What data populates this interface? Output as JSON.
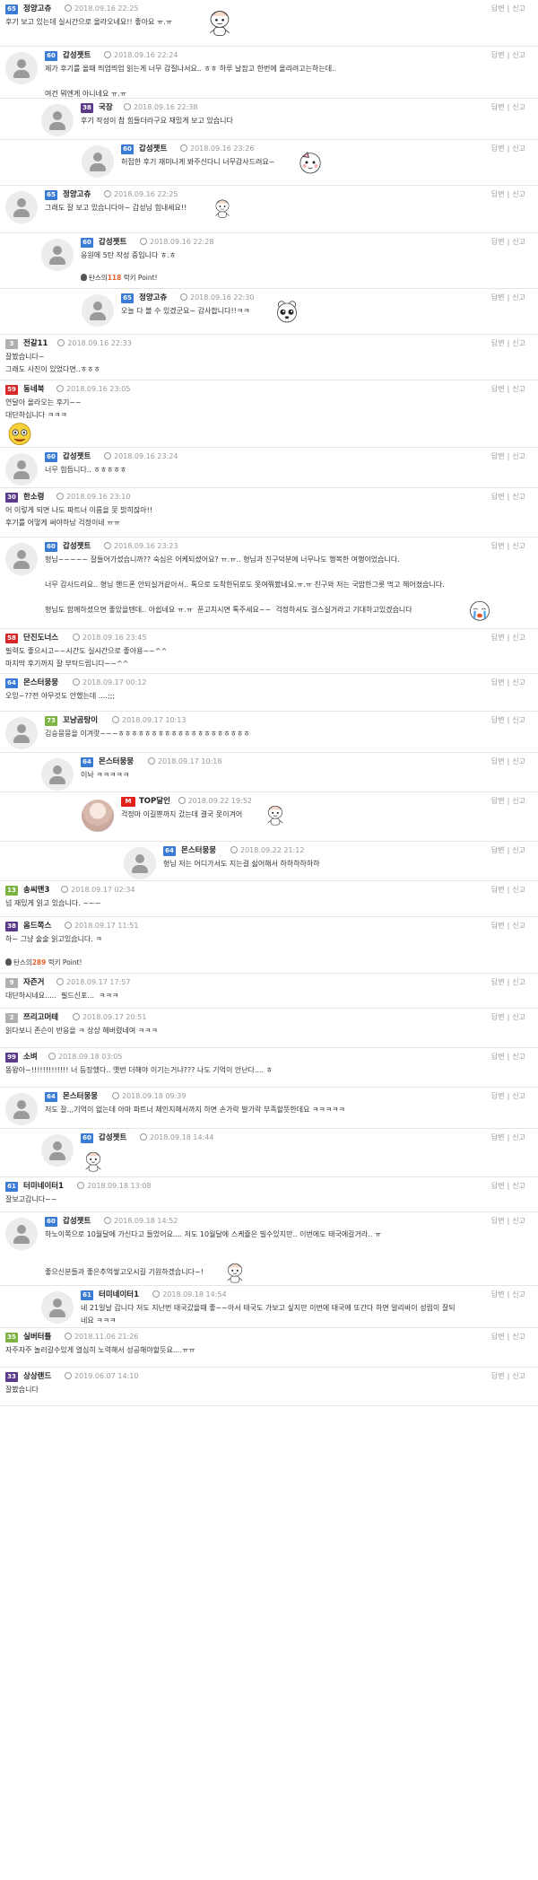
{
  "ui": {
    "reply": "답변",
    "report": "신고"
  },
  "comments": [
    {
      "level": "65",
      "nick": "정양고츄",
      "date": "2018.09.16 22:25",
      "body": "후기 보고 있는데 실시간으로 올라오네요!! 좋아요 ㅠ.ㅠ",
      "sticker": "sticker-mouse-character"
    },
    {
      "level": "60",
      "nick": "갑성젯트",
      "date": "2018.09.16 22:24",
      "body": "제가 후기를 올때 띄엄띄엄 읽는게 너무 감질나서요.. ㅎㅎ 하루 날잡고 한번에 올리려고는하는데..\n\n여건 뭐엔게 아니네요 ㅠ.ㅠ"
    },
    {
      "level": "38",
      "nick": "국장",
      "date": "2018.09.16 22:38",
      "body": "후기 작성이 참 힘들더라구요 재밌게 보고 있습니다"
    },
    {
      "level": "60",
      "nick": "갑성젯트",
      "date": "2018.09.16 23:26",
      "body": "허접한 후기 재미나게 봐주신다니 너무감사드려요~",
      "sticker": "sticker-face-character"
    },
    {
      "level": "65",
      "nick": "정양고츄",
      "date": "2018.09.16 22:25",
      "body": "그래도 잘 보고 있습니다아~ 갑성님 힘내세요!!",
      "sticker": "sticker-cheer-character"
    },
    {
      "level": "60",
      "nick": "갑성젯트",
      "date": "2018.09.16 22:28",
      "body": "응원에 5탄 작성 중입니다 ㅎ.ㅎ",
      "point_prefix": "탄스의",
      "point_amount": "118",
      "point_suffix": "럭키 Point!"
    },
    {
      "level": "65",
      "nick": "정양고츄",
      "date": "2018.09.16 22:30",
      "body": "오늘 다 볼 수 있겠군요~ 감사합니다!!ㅋㅋ",
      "sticker": "sticker-bear-character"
    },
    {
      "level": "3",
      "nick": "전갈11",
      "date": "2018.09.16 22:33",
      "body": "잘봤습니다~\n그래도 사진이 있었다면..ㅎㅎㅎ"
    },
    {
      "level": "59",
      "nick": "동네북",
      "date": "2018.09.16 23:05",
      "body": "연달아 올라오는 후기~~\n대단하십니다 ㅋㅋㅋ",
      "sticker": "sticker-yellow-character"
    },
    {
      "level": "60",
      "nick": "갑성젯트",
      "date": "2018.09.16 23:24",
      "body": "너무 힘듭니다.. ㅎㅎㅎㅎㅎ"
    },
    {
      "level": "30",
      "nick": "한소령",
      "date": "2018.09.16 23:10",
      "body": "어 이렇게 되면 나도 파트너 이름을 못 밝히잖아!!\n후기를 어떻게 써야하남 걱정이네 ㅠㅠ"
    },
    {
      "level": "60",
      "nick": "갑성젯트",
      "date": "2018.09.16 23:23",
      "body": "형님~~~~~ 잘들어가셨습니까?? 숙심은 어케되셨어요? ㅠ.ㅠ.. 형님과 친구덕분에 너무나도 행복한 여행이었습니다.\n\n너무 감사드려요.. 형님 핸드폰 안되실거같아서.. 톡으로 도착한뒤로도 못여쭤봤네요.ㅠ.ㅠ 친구와 저는 국밥한그릇 먹고 헤어졌습니다.\n\n형님도 함께하셨으면 좋았을텐데.. 아쉽네요 ㅠ.ㅠ  푼고치시면 톡주세요~~  걱정하셔도 걸스실거라고 기대하고있겠습니다",
      "sticker": "sticker-crying-character"
    },
    {
      "level": "58",
      "nick": "단진도너스",
      "date": "2018.09.16 23:45",
      "body": "필력도 좋으시고~~시간도 실시간으로 좋아용~~^^\n마지막 후기까지 잘 부탁드립니다~~^^"
    },
    {
      "level": "64",
      "nick": "몬스터뭉뭉",
      "date": "2018.09.17 00:12",
      "body": "오잉~??전 아무것도 안했는데 ....;;;"
    },
    {
      "level": "73",
      "nick": "꼬냥곰탕이",
      "date": "2018.09.17 10:13",
      "body": "김승뭉뭉을 이겨랏~~~ㅎㅎㅎㅎㅎㅎㅎㅎㅎㅎㅎㅎㅎㅎㅎㅎㅎㅎㅎㅎ"
    },
    {
      "level": "64",
      "nick": "몬스터뭉뭉",
      "date": "2018.09.17 10:18",
      "body": "이놔 ㅋㅋㅋㅋㅋ"
    },
    {
      "level": "M",
      "nick": "TOP달인",
      "date": "2018.09.22 19:52",
      "body": "걱정마 이길뿐까지 갔는데 결국 못이겨어",
      "sticker": "sticker-small-character"
    },
    {
      "level": "64",
      "nick": "몬스터뭉뭉",
      "date": "2018.09.22 21:12",
      "body": "형님 저는 어디가서도 지는걸 싫어해서 하하하하하하"
    },
    {
      "level": "13",
      "nick": "송씨맨3",
      "date": "2018.09.17 02:34",
      "body": "넘 재밌게 읽고 있습니다. ~~~"
    },
    {
      "level": "38",
      "nick": "옴드쪽스",
      "date": "2018.09.17 11:51",
      "body": "하~ 그냥 술술 읽고있습니다. ㅋ",
      "point_prefix": "탄스의",
      "point_amount": "289",
      "point_suffix": "럭키 Point!"
    },
    {
      "level": "9",
      "nick": "자즌거",
      "date": "2018.09.17 17:57",
      "body": "대단하시네요.....  필드신포...  ㅋㅋㅋ"
    },
    {
      "level": "2",
      "nick": "쯔리고머테",
      "date": "2018.09.17 20:51",
      "body": "읽다보니 존슨이 반응을 ㅋ 상상 해버렸네여 ㅋㅋㅋ"
    },
    {
      "level": "99",
      "nick": "소벼",
      "date": "2018.09.18 03:05",
      "body": "똥왕아~!!!!!!!!!!!!! 너 등장했다.. 옛번 더해야 이기는거냐??? 나도 기억이 안난다.... ㅎ"
    },
    {
      "level": "64",
      "nick": "몬스터뭉뭉",
      "date": "2018.09.18 09:39",
      "body": "저도 잘.,,기억이 없는데 아마 파트너 체인지해서까지 하면 손가락 발가락 부족할뜻한데요 ㅋㅋㅋㅋㅋ"
    },
    {
      "level": "60",
      "nick": "갑성젯트",
      "date": "2018.09.18 14:44",
      "body": "",
      "sticker": "sticker-small-character"
    },
    {
      "level": "61",
      "nick": "터미네이터1",
      "date": "2018.09.18 13:08",
      "body": "잘보고갑니다~~"
    },
    {
      "level": "60",
      "nick": "갑성젯트",
      "date": "2018.09.18 14:52",
      "body": "하노이쪽으로 10월달에 가신다고 들었어요.... 저도 10월달에 스케쥴은 빌수있지만.. 이번에도 태국에갈거라.. ㅠ\n\n\n좋으신분들과 좋은추억쌓고오시길 기원하겠습니다~!",
      "sticker": "sticker-small-character"
    },
    {
      "level": "61",
      "nick": "터미네이터1",
      "date": "2018.09.18 14:54",
      "body": "네 21일날 갑니다 저도 지난번 태국갔을때 좋~~아서 태국도 가보고 싶지만 이번에 태국에 또간다 하면 알리바이 성립이 잘되\n네요 ㅋㅋㅋ"
    },
    {
      "level": "35",
      "nick": "실버터틀",
      "date": "2018.11.06 21:26",
      "body": "자주자주 놀러갈수있게 열심히 노력해서 성공해야할듯요....ㅠㅠ"
    },
    {
      "level": "33",
      "nick": "상상랜드",
      "date": "2019.06.07 14:10",
      "body": "잘봤습니다"
    }
  ],
  "colors": {
    "level_65": "#3a7bd5",
    "level_60": "#3a7bd5",
    "level_38": "#5b3a8a",
    "level_3": "#b0b0b0",
    "level_59": "#d62828",
    "level_30": "#5b3a8a",
    "level_58": "#d62828",
    "level_64": "#3a7bd5",
    "level_73": "#7cb342",
    "level_13": "#7cb342",
    "level_9": "#b0b0b0",
    "level_2": "#b0b0b0",
    "level_99": "#5b3a8a",
    "level_61": "#3a7bd5",
    "level_35": "#7cb342",
    "level_33": "#5b3a8a",
    "vip": "#e2211c",
    "point": "#e8622c"
  }
}
